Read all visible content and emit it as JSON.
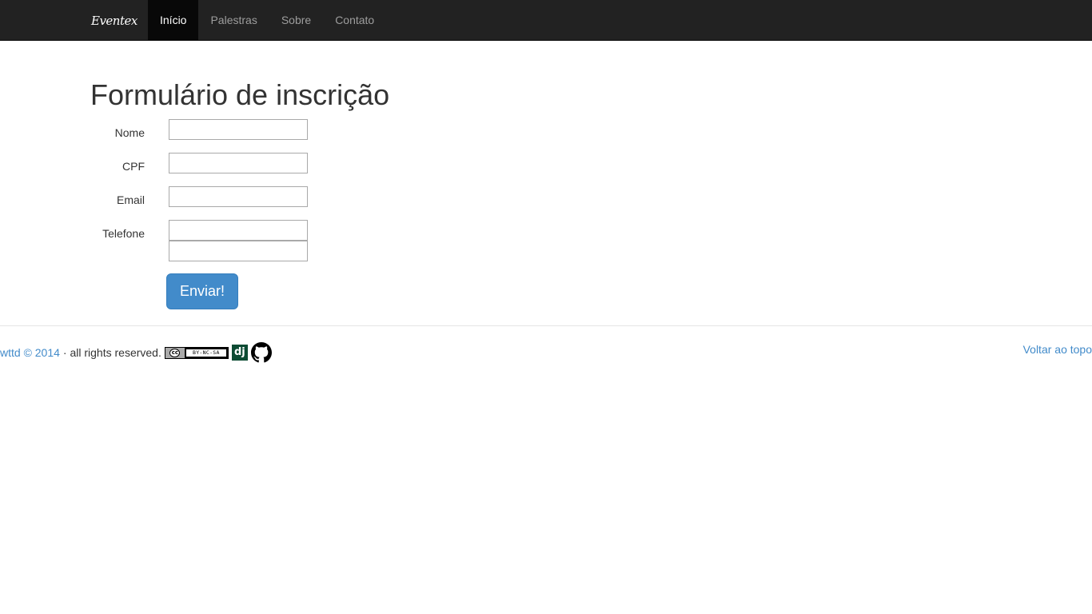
{
  "navbar": {
    "brand": "Eventex",
    "items": [
      {
        "label": "Início",
        "active": true
      },
      {
        "label": "Palestras",
        "active": false
      },
      {
        "label": "Sobre",
        "active": false
      },
      {
        "label": "Contato",
        "active": false
      }
    ]
  },
  "form": {
    "title": "Formulário de inscrição",
    "fields": [
      {
        "label": "Nome",
        "value": ""
      },
      {
        "label": "CPF",
        "value": ""
      },
      {
        "label": "Email",
        "value": ""
      },
      {
        "label": "Telefone",
        "value": "",
        "value2": ""
      }
    ],
    "submit_label": "Enviar!"
  },
  "footer": {
    "copyright_link": "wttd © 2014",
    "rights_text": "· all rights reserved.",
    "license": {
      "cc": "cc",
      "terms": "BY-NC-SA"
    },
    "django_icon_text": "dj",
    "back_to_top": "Voltar ao topo"
  },
  "colors": {
    "navbar_bg": "#222222",
    "link": "#428bca",
    "primary_button": "#428bca",
    "django_green": "#0c4b33"
  },
  "icons": [
    "creative-commons-license-icon",
    "django-icon",
    "github-icon"
  ]
}
